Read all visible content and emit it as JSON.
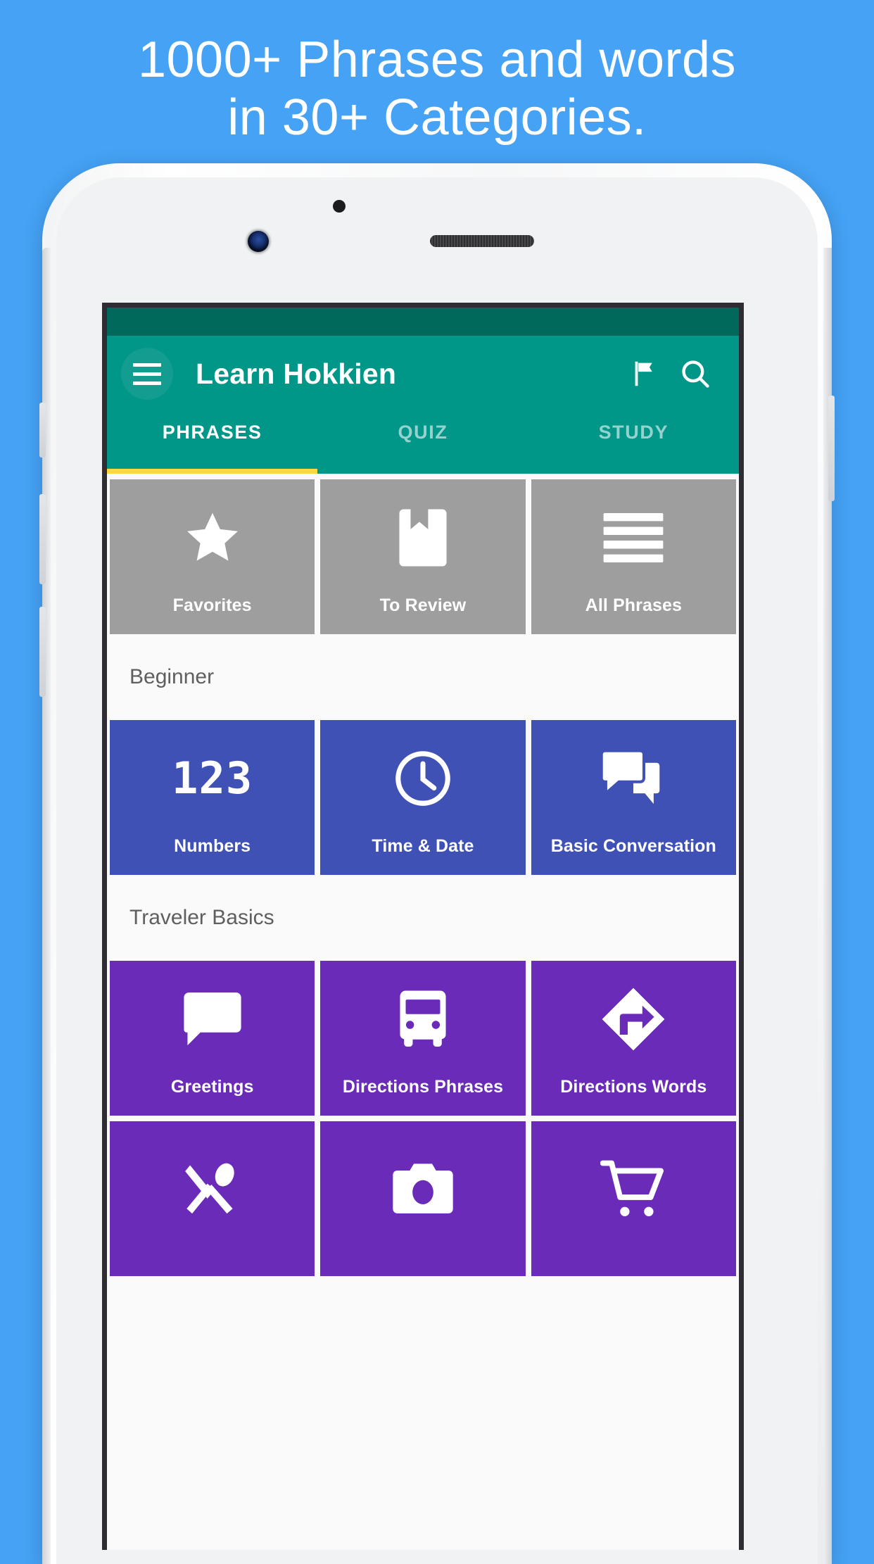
{
  "promo": {
    "headline": "1000+ Phrases and words\nin 30+ Categories."
  },
  "colors": {
    "background": "#45a2f5",
    "app_bar": "#009688",
    "status_bar": "#00695c",
    "tab_indicator": "#ffd740",
    "tile_gray": "#9e9e9e",
    "tile_blue": "#3f51b5",
    "tile_purple": "#6a2cb8"
  },
  "app": {
    "title": "Learn Hokkien",
    "menu_icon": "hamburger-menu-icon",
    "actions": [
      {
        "name": "flag-icon",
        "label": "Flag"
      },
      {
        "name": "search-icon",
        "label": "Search"
      }
    ],
    "tabs": [
      {
        "label": "PHRASES",
        "active": true
      },
      {
        "label": "QUIZ",
        "active": false
      },
      {
        "label": "STUDY",
        "active": false
      }
    ],
    "quick_tiles": [
      {
        "label": "Favorites",
        "icon": "star-icon"
      },
      {
        "label": "To Review",
        "icon": "bookmark-icon"
      },
      {
        "label": "All Phrases",
        "icon": "list-lines-icon"
      }
    ],
    "sections": [
      {
        "title": "Beginner",
        "color": "blue",
        "tiles": [
          {
            "label": "Numbers",
            "icon": "numbers-123-icon"
          },
          {
            "label": "Time & Date",
            "icon": "clock-icon"
          },
          {
            "label": "Basic Conversation",
            "icon": "chat-bubbles-icon"
          }
        ]
      },
      {
        "title": "Traveler Basics",
        "color": "purple",
        "tiles": [
          {
            "label": "Greetings",
            "icon": "speech-bubble-icon"
          },
          {
            "label": "Directions Phrases",
            "icon": "bus-icon"
          },
          {
            "label": "Directions Words",
            "icon": "turn-right-sign-icon"
          }
        ],
        "tiles_partial": [
          {
            "label": "",
            "icon": "restaurant-icon"
          },
          {
            "label": "",
            "icon": "camera-icon"
          },
          {
            "label": "",
            "icon": "shopping-cart-icon"
          }
        ]
      }
    ]
  }
}
